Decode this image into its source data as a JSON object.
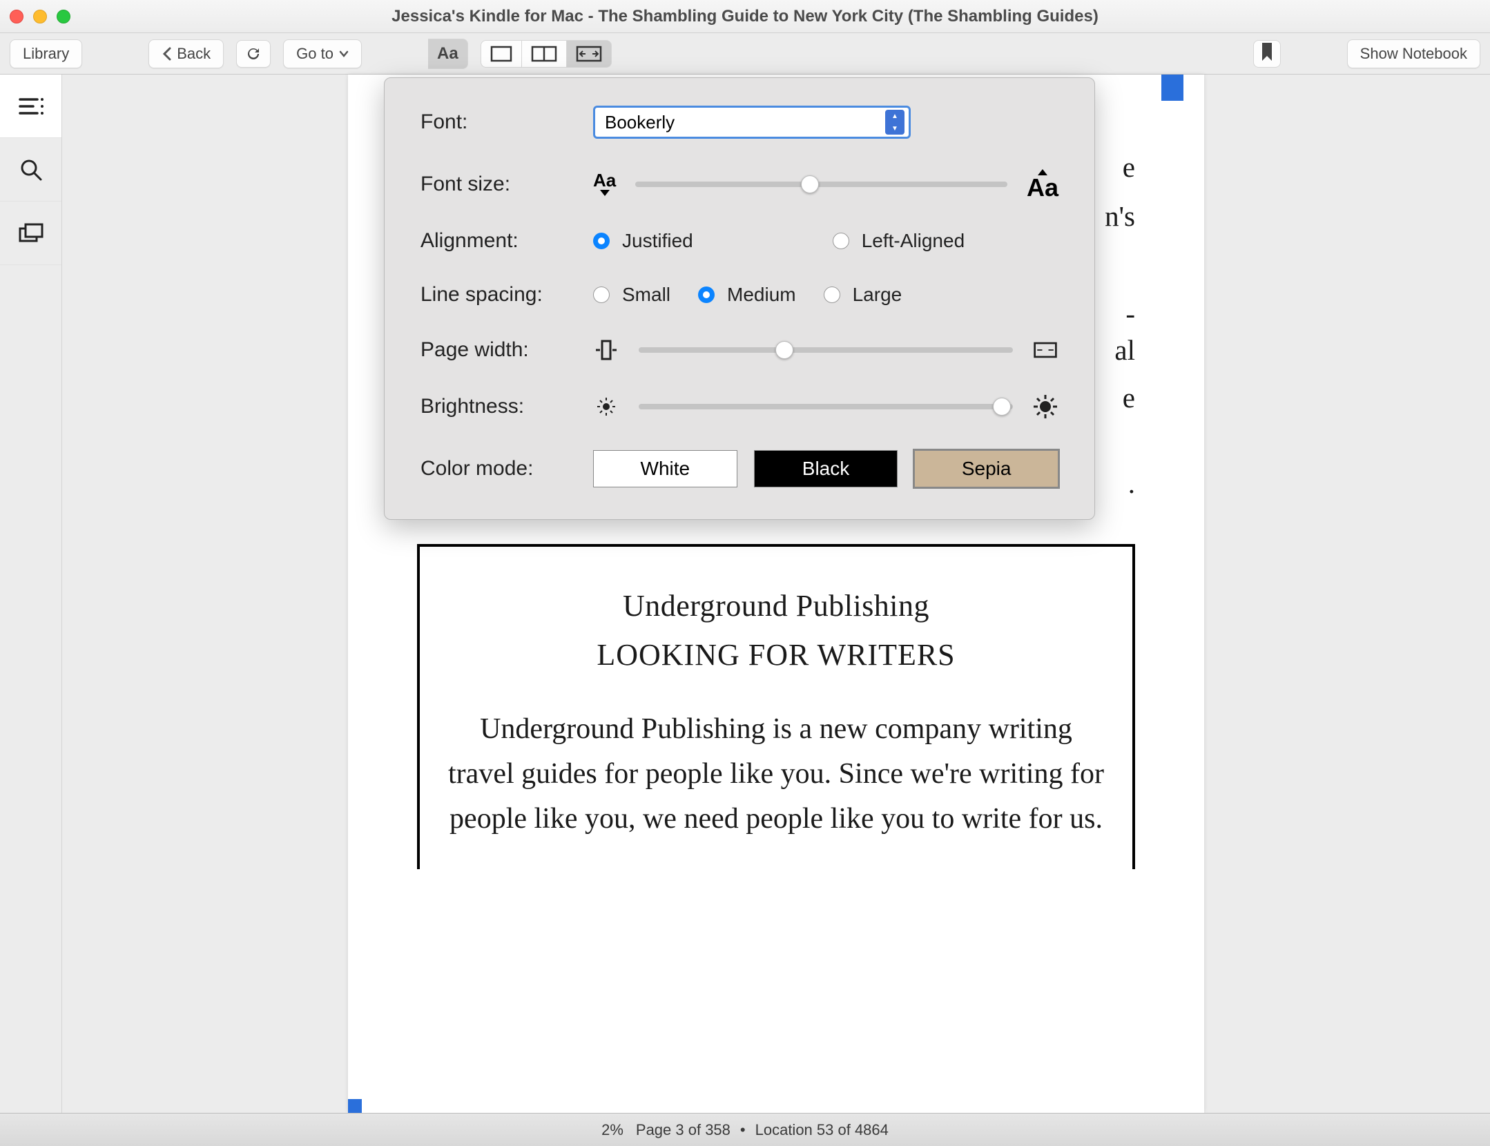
{
  "window": {
    "title": "Jessica's Kindle for Mac - The Shambling Guide to New York City (The Shambling Guides)"
  },
  "toolbar": {
    "library": "Library",
    "back": "Back",
    "goto": "Go to",
    "aa": "Aa",
    "show_notebook": "Show Notebook"
  },
  "popover": {
    "labels": {
      "font": "Font:",
      "font_size": "Font size:",
      "alignment": "Alignment:",
      "line_spacing": "Line spacing:",
      "page_width": "Page width:",
      "brightness": "Brightness:",
      "color_mode": "Color mode:"
    },
    "font_selected": "Bookerly",
    "font_size_pct": 47,
    "alignment": {
      "options": [
        "Justified",
        "Left-Aligned"
      ],
      "selected": "Justified"
    },
    "line_spacing": {
      "options": [
        "Small",
        "Medium",
        "Large"
      ],
      "selected": "Medium"
    },
    "page_width_pct": 39,
    "brightness_pct": 97,
    "color_mode": {
      "options": [
        "White",
        "Black",
        "Sepia"
      ],
      "selected": "Sepia"
    }
  },
  "page": {
    "frag_lines": [
      "e",
      "n's",
      "",
      "-",
      "al",
      "e",
      "",
      ".",
      ""
    ],
    "frame_h1": "Underground Publishing",
    "frame_h2": "LOOKING FOR WRITERS",
    "frame_p": "Underground Publishing is a new company writing travel guides for people like you. Since we're writing for people like you, we need people like you to write for us."
  },
  "status": {
    "percent": "2%",
    "page": "Page 3 of 358",
    "sep": "•",
    "location": "Location 53 of 4864"
  }
}
